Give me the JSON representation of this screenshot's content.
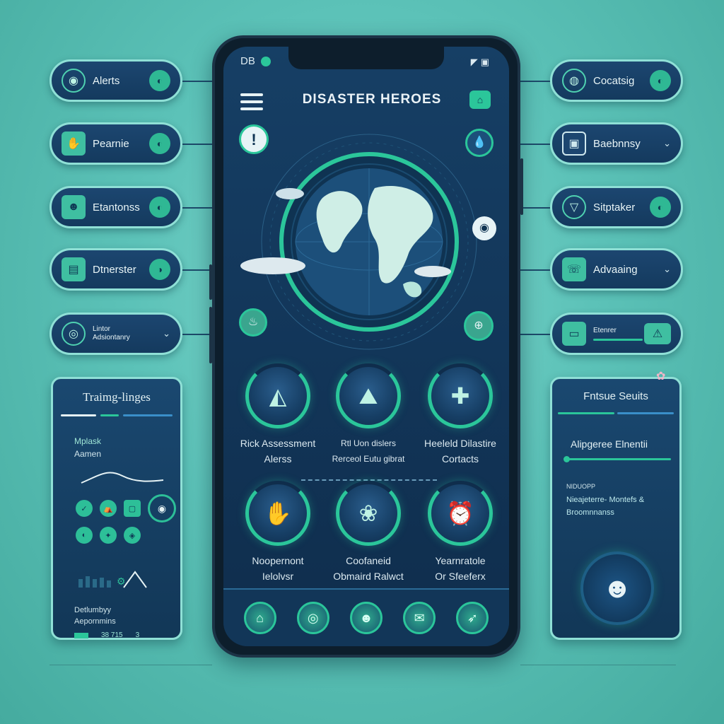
{
  "app": {
    "logo": "DB",
    "title": "DISASTER HEROES",
    "status_icons": [
      "signal-icon",
      "battery-icon"
    ]
  },
  "left_pills": [
    {
      "label": "Alerts",
      "lead_icon": "gauge-icon",
      "trail_icon": "toggle-icon"
    },
    {
      "label": "Pearnie",
      "lead_icon": "hands-icon",
      "trail_icon": "toggle-icon"
    },
    {
      "label": "Etantonss",
      "lead_icon": "people-icon",
      "trail_icon": "toggle-icon"
    },
    {
      "label": "Dtnerster",
      "lead_icon": "document-icon",
      "trail_icon": "toggle-icon"
    },
    {
      "label_line1": "Lintor",
      "label_line2": "Adsiontanry",
      "lead_icon": "target-icon",
      "trail_icon": "chevron-down-icon"
    }
  ],
  "right_pills": [
    {
      "label": "Cocatsig",
      "lead_icon": "globe-icon",
      "trail_icon": "toggle-icon"
    },
    {
      "label": "Baebnnsy",
      "lead_icon": "monitor-icon",
      "trail_icon": "chevron-down-icon"
    },
    {
      "label": "Sitptaker",
      "lead_icon": "funnel-icon",
      "trail_icon": "toggle-icon"
    },
    {
      "label": "Advaaing",
      "lead_icon": "phone-icon",
      "trail_icon": "chevron-down-icon"
    },
    {
      "label": "Etenrer",
      "lead_icon": "card-icon",
      "trail_icon": "warning-icon"
    }
  ],
  "left_card": {
    "title": "Traimg-linges",
    "subtitle_line1": "Mplask",
    "subtitle_line2": "Aamen",
    "footer_line1": "Detlumbyy",
    "footer_line2": "Aepornmins",
    "footer_nums": [
      "38 715",
      "3"
    ]
  },
  "right_card": {
    "title": "Fntsue Seuits",
    "section_title": "Alipgeree Elnentii",
    "caption": "NIDUOPP",
    "body_line1": "Nieajeterre- Montefs &",
    "body_line2": "Broomnnanss"
  },
  "features": [
    {
      "line1": "Rick Assessment",
      "line2": "Alerss",
      "icon": "water-drop-icon"
    },
    {
      "line1": "Rtl Uon dislers",
      "line2": "Rerceol Eutu gibrat",
      "icon": "people-map-icon"
    },
    {
      "line1": "Heeleld Dilastire",
      "line2": "Cortacts",
      "icon": "medical-shield-icon"
    },
    {
      "line1": "Noopernont",
      "line2": "Ielolvsr",
      "icon": "hand-icon"
    },
    {
      "line1": "Coofaneid",
      "line2": "Obmaird Ralwct",
      "icon": "plant-icon"
    },
    {
      "line1": "Yearnratole",
      "line2": "Or Sfeeferx",
      "icon": "alarm-icon"
    }
  ],
  "nav": [
    {
      "icon": "home-icon"
    },
    {
      "icon": "radar-icon"
    },
    {
      "icon": "people-icon"
    },
    {
      "icon": "chat-icon"
    },
    {
      "icon": "compass-icon"
    }
  ],
  "colors": {
    "accent": "#2bc69a",
    "panel": "#143a5e",
    "border": "#8fe0d6",
    "background": "#5cc2b8"
  }
}
